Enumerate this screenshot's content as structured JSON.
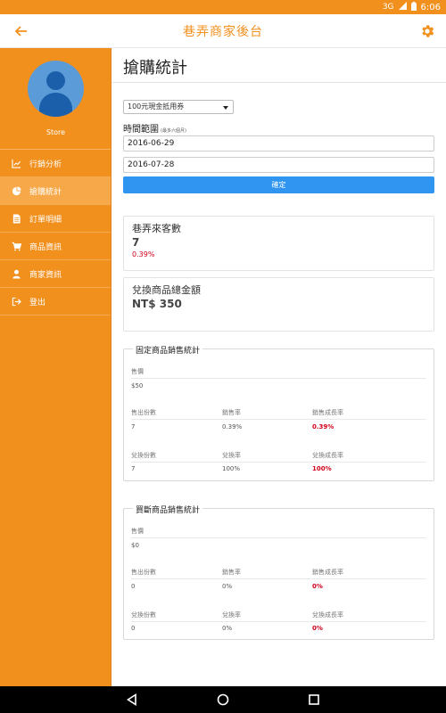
{
  "status_bar": {
    "network": "3G",
    "time": "6:06"
  },
  "app_bar": {
    "title": "巷弄商家後台"
  },
  "sidebar": {
    "store_label": "Store",
    "items": [
      {
        "label": "行銷分析",
        "icon": "line-chart-icon"
      },
      {
        "label": "搶購統計",
        "icon": "pie-chart-icon"
      },
      {
        "label": "訂單明細",
        "icon": "document-icon"
      },
      {
        "label": "商品資訊",
        "icon": "shopping-cart-icon"
      },
      {
        "label": "商家資訊",
        "icon": "user-icon"
      },
      {
        "label": "登出",
        "icon": "sign-out-icon"
      }
    ],
    "active_index": 1
  },
  "page": {
    "title": "搶購統計",
    "coupon_select": {
      "value": "100元現金抵用券"
    },
    "range_label": "時間範圍",
    "range_hint": "(最多六個月)",
    "start_date": "2016-06-29",
    "end_date": "2016-07-28",
    "confirm_label": "確定"
  },
  "visitors_card": {
    "label": "巷弄來客數",
    "value": "7",
    "percent": "0.39%"
  },
  "redeem_card": {
    "label": "兌換商品總金額",
    "value": "NT$ 350"
  },
  "fixed_stats": {
    "legend": "固定商品銷售統計",
    "price_label": "售價",
    "price_value": "$50",
    "sold_label": "售出份數",
    "sold_value": "7",
    "sell_rate_label": "銷售率",
    "sell_rate_value": "0.39%",
    "sell_growth_label": "銷售成長率",
    "sell_growth_value": "0.39%",
    "redeem_label": "兌換份數",
    "redeem_value": "7",
    "redeem_rate_label": "兌換率",
    "redeem_rate_value": "100%",
    "redeem_growth_label": "兌換成長率",
    "redeem_growth_value": "100%"
  },
  "sellout_stats": {
    "legend": "買斷商品銷售統計",
    "price_label": "售價",
    "price_value": "$0",
    "sold_label": "售出份數",
    "sold_value": "0",
    "sell_rate_label": "銷售率",
    "sell_rate_value": "0%",
    "sell_growth_label": "銷售成長率",
    "sell_growth_value": "0%",
    "redeem_label": "兌換份數",
    "redeem_value": "0",
    "redeem_rate_label": "兌換率",
    "redeem_rate_value": "0%",
    "redeem_growth_label": "兌換成長率",
    "redeem_growth_value": "0%"
  },
  "colors": {
    "brand": "#f2901e",
    "button": "#2f95f0",
    "negative": "#d0021b"
  }
}
